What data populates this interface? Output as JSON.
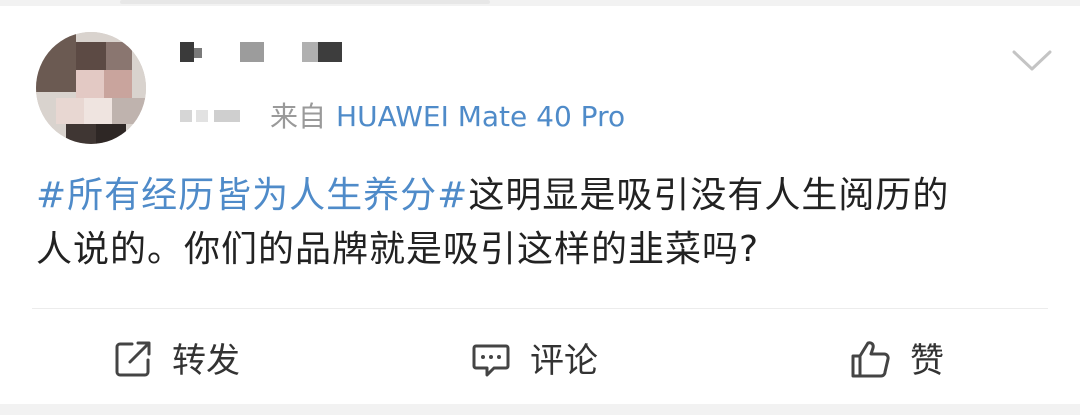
{
  "post": {
    "author_name": "",
    "source_prefix": "来自",
    "source_device": "HUAWEI Mate 40 Pro",
    "content_topic": "#所有经历皆为人生养分#",
    "content_line1_rest": "这明显是吸引没有人生阅历的",
    "content_line2": "人说的。你们的品牌就是吸引这样的韭菜吗?"
  },
  "actions": {
    "repost_label": "转发",
    "comment_label": "评论",
    "like_label": "赞"
  },
  "icons": {
    "avatar": "blurred-avatar",
    "more": "chevron-down-icon",
    "repost": "share-square-icon",
    "comment": "comment-bubble-icon",
    "like": "thumbs-up-icon"
  },
  "colors": {
    "link": "#4f8bc9",
    "text": "#222222",
    "meta": "#9a9a9a",
    "icon": "#444444"
  }
}
